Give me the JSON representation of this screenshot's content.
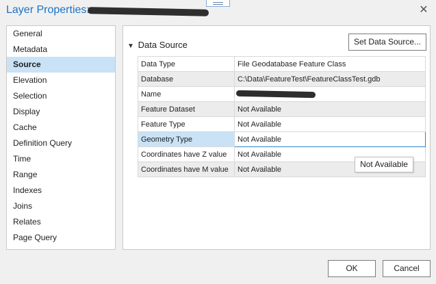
{
  "window": {
    "title": "Layer Properties:",
    "close_glyph": "✕"
  },
  "nav": {
    "items": [
      {
        "label": "General"
      },
      {
        "label": "Metadata"
      },
      {
        "label": "Source"
      },
      {
        "label": "Elevation"
      },
      {
        "label": "Selection"
      },
      {
        "label": "Display"
      },
      {
        "label": "Cache"
      },
      {
        "label": "Definition Query"
      },
      {
        "label": "Time"
      },
      {
        "label": "Range"
      },
      {
        "label": "Indexes"
      },
      {
        "label": "Joins"
      },
      {
        "label": "Relates"
      },
      {
        "label": "Page Query"
      }
    ],
    "selected": "Source"
  },
  "source": {
    "section_title": "Data Source",
    "chevron_icon": "chevron-down-icon",
    "set_button": "Set Data Source...",
    "rows": [
      {
        "key": "Data Type",
        "value": "File Geodatabase Feature Class"
      },
      {
        "key": "Database",
        "value": "C:\\Data\\FeatureTest\\FeatureClassTest.gdb"
      },
      {
        "key": "Name",
        "value": ""
      },
      {
        "key": "Feature Dataset",
        "value": "Not Available"
      },
      {
        "key": "Feature Type",
        "value": "Not Available"
      },
      {
        "key": "Geometry Type",
        "value": "Not Available"
      },
      {
        "key": "Coordinates have Z value",
        "value": "Not Available"
      },
      {
        "key": "Coordinates have M value",
        "value": "Not Available"
      }
    ],
    "selected_row": "Geometry Type",
    "tooltip": "Not Available"
  },
  "footer": {
    "ok": "OK",
    "cancel": "Cancel"
  },
  "colors": {
    "title": "#1a73c8",
    "selection": "#c9e2f6",
    "focus_border": "#2a84d2"
  }
}
